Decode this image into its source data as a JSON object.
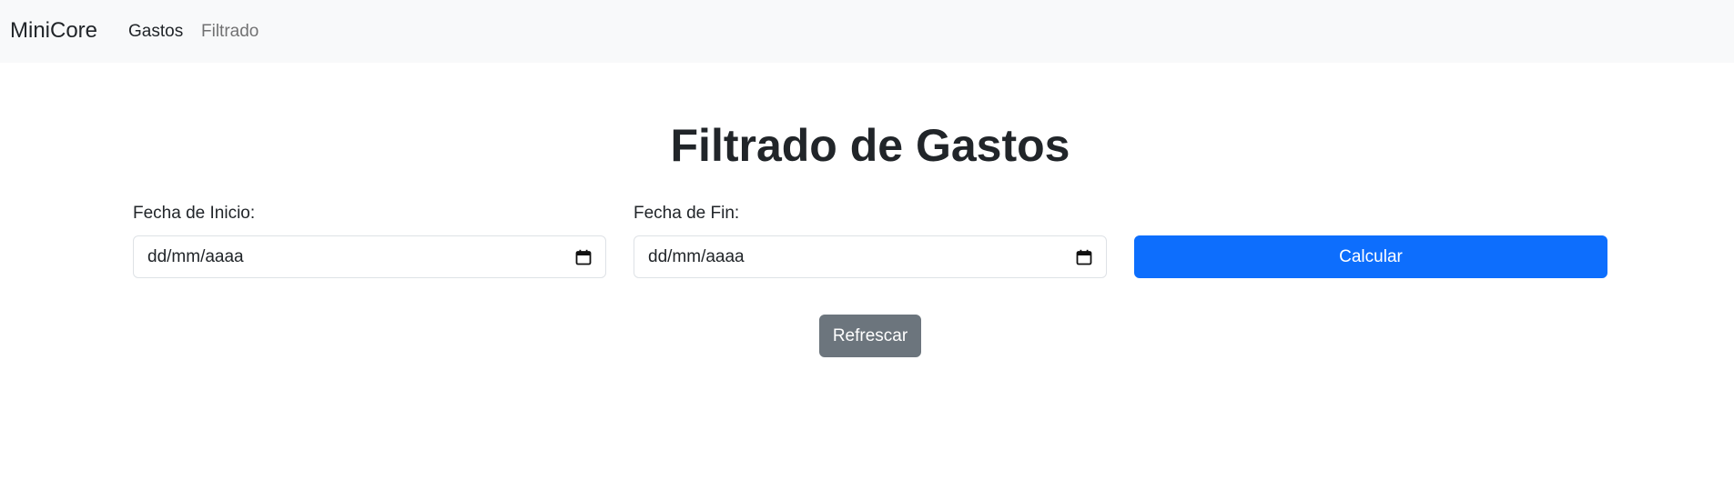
{
  "navbar": {
    "brand": "MiniCore",
    "links": [
      {
        "label": "Gastos",
        "state": "active"
      },
      {
        "label": "Filtrado",
        "state": "muted"
      }
    ],
    "background": "#f8f9fa"
  },
  "page": {
    "title": "Filtrado de Gastos"
  },
  "form": {
    "start_label": "Fecha de Inicio:",
    "start_value": "dd/mm/aaaa",
    "end_label": "Fecha de Fin:",
    "end_value": "dd/mm/aaaa",
    "calendar_icon": "calendar-icon",
    "calculate_label": "Calcular",
    "refresh_label": "Refrescar"
  },
  "colors": {
    "primary": "#0d6efd",
    "secondary": "#6c757d",
    "text": "#212529"
  }
}
